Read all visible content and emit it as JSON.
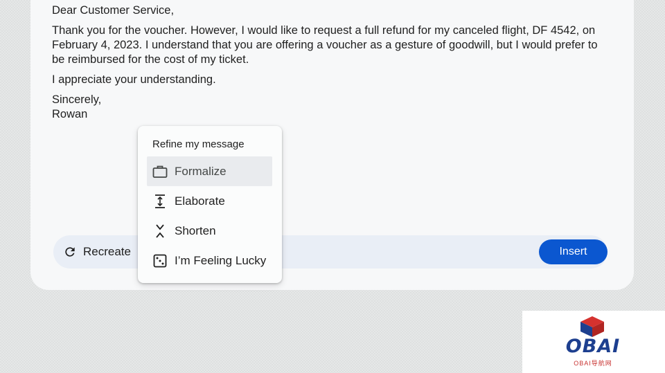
{
  "letter": {
    "greeting": "Dear Customer Service,",
    "body": "Thank you for the voucher. However, I would like to request a full refund for my canceled flight, DF 4542, on February 4, 2023. I understand that you are offering a voucher as a gesture of goodwill, but I would prefer to be reimbursed for the cost of my ticket.",
    "closing_line": "I appreciate your understanding.",
    "signoff": "Sincerely,",
    "name": "Rowan"
  },
  "toolbar": {
    "recreate_label": "Recreate",
    "insert_label": "Insert"
  },
  "menu": {
    "title": "Refine my message",
    "items": [
      {
        "label": "Formalize",
        "icon": "briefcase-icon",
        "active": true
      },
      {
        "label": "Elaborate",
        "icon": "expand-vertical-icon"
      },
      {
        "label": "Shorten",
        "icon": "compress-vertical-icon"
      },
      {
        "label": "I’m Feeling Lucky",
        "icon": "dice-icon"
      }
    ]
  },
  "watermark": {
    "logo_text": "OBAI",
    "logo_subtext": "OBAI导航网"
  },
  "colors": {
    "accent": "#0b57d0",
    "toolbar_bg": "#e9eef6",
    "card_bg": "#f7f8f9"
  }
}
